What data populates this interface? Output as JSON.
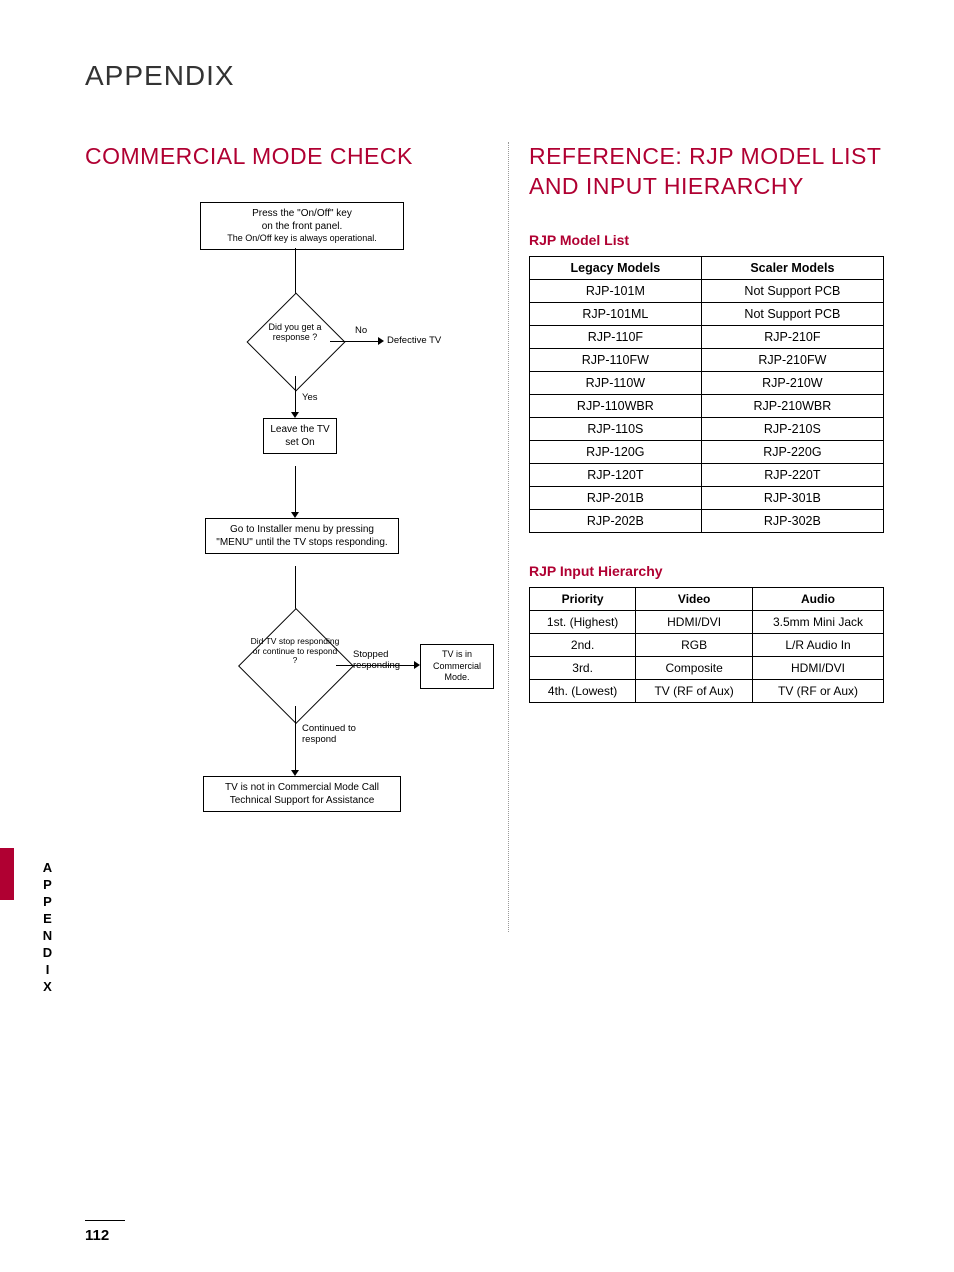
{
  "page_title": "APPENDIX",
  "page_number": "112",
  "side_label": "APPENDIX",
  "left": {
    "heading": "COMMERCIAL MODE CHECK",
    "flow": {
      "start_line1": "Press the \"On/Off\" key",
      "start_line2": "on the front panel.",
      "start_line3": "The On/Off key is always operational.",
      "d1": "Did you get a response ?",
      "d1_no": "No",
      "d1_no_result": "Defective TV",
      "d1_yes": "Yes",
      "leave_on": "Leave the TV set On",
      "installer": "Go to Installer menu by pressing \"MENU\" until the TV stops responding.",
      "d2": "Did TV stop responding or continue to respond ?",
      "d2_stopped": "Stopped responding",
      "d2_commercial": "TV is in Commercial Mode.",
      "d2_continued": "Continued to respond",
      "not_commercial": "TV is not in Commercial Mode Call Technical Support for Assistance"
    }
  },
  "right": {
    "heading": "REFERENCE: RJP MODEL LIST AND INPUT HIERARCHY",
    "model_list_title": "RJP Model List",
    "model_headers": {
      "legacy": "Legacy Models",
      "scaler": "Scaler Models"
    },
    "models": [
      {
        "legacy": "RJP-101M",
        "scaler": "Not Support PCB"
      },
      {
        "legacy": "RJP-101ML",
        "scaler": "Not Support PCB"
      },
      {
        "legacy": "RJP-110F",
        "scaler": "RJP-210F"
      },
      {
        "legacy": "RJP-110FW",
        "scaler": "RJP-210FW"
      },
      {
        "legacy": "RJP-110W",
        "scaler": "RJP-210W"
      },
      {
        "legacy": "RJP-110WBR",
        "scaler": "RJP-210WBR"
      },
      {
        "legacy": "RJP-110S",
        "scaler": "RJP-210S"
      },
      {
        "legacy": "RJP-120G",
        "scaler": "RJP-220G"
      },
      {
        "legacy": "RJP-120T",
        "scaler": "RJP-220T"
      },
      {
        "legacy": "RJP-201B",
        "scaler": "RJP-301B"
      },
      {
        "legacy": "RJP-202B",
        "scaler": "RJP-302B"
      }
    ],
    "hierarchy_title": "RJP Input Hierarchy",
    "hierarchy_headers": {
      "priority": "Priority",
      "video": "Video",
      "audio": "Audio"
    },
    "hierarchy": [
      {
        "priority": "1st. (Highest)",
        "video": "HDMI/DVI",
        "audio": "3.5mm Mini Jack"
      },
      {
        "priority": "2nd.",
        "video": "RGB",
        "audio": "L/R Audio In"
      },
      {
        "priority": "3rd.",
        "video": "Composite",
        "audio": "HDMI/DVI"
      },
      {
        "priority": "4th. (Lowest)",
        "video": "TV (RF of Aux)",
        "audio": "TV (RF or Aux)"
      }
    ]
  }
}
